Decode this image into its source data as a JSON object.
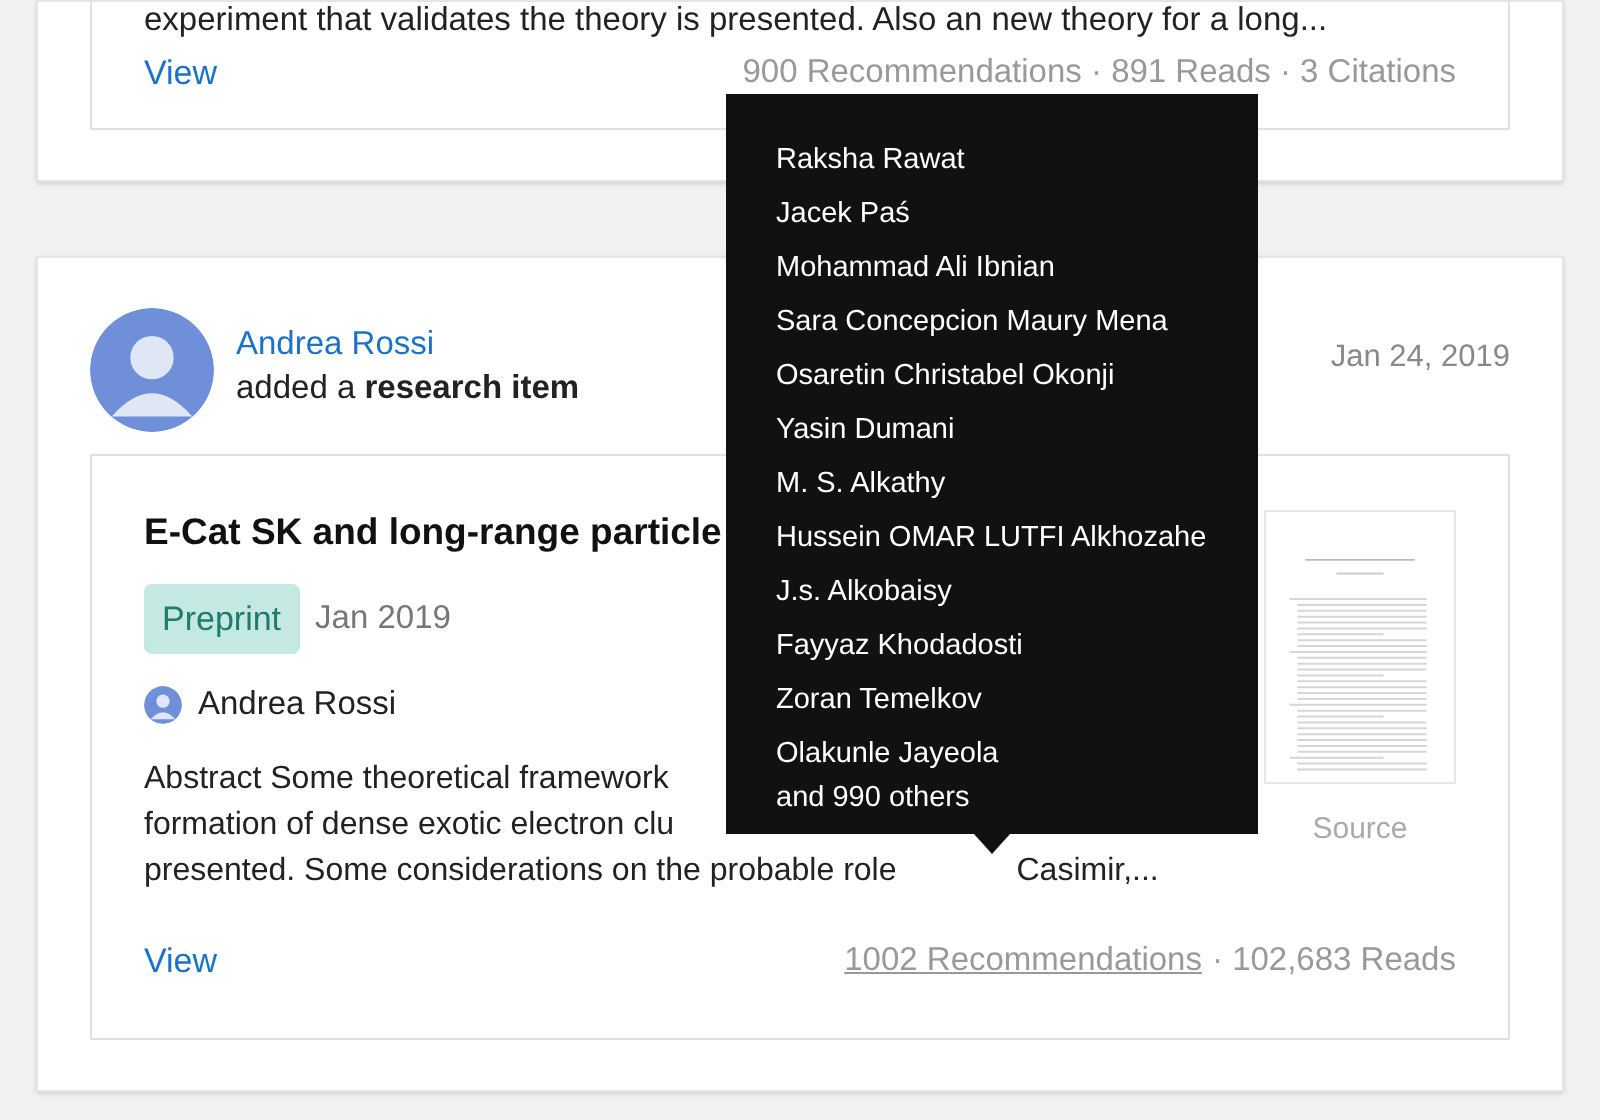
{
  "previous_item": {
    "excerpt": "experiment that validates the theory is presented. Also an new theory for a long...",
    "view_link": "View",
    "stats": "900 Recommendations · 891 Reads · 3 Citations"
  },
  "item": {
    "author": "Andrea Rossi",
    "action": "added a **research item**",
    "date": "Jan 24, 2019",
    "title": "E-Cat SK and long-range particle",
    "type_badge": "Preprint",
    "pub_date": "Jan 2019",
    "authors": [
      "Andrea Rossi"
    ],
    "abstract_lines": [
      "Abstract Some theoretical framework",
      "formation of dense exotic electron clu",
      "presented. Some considerations on the probable role"
    ],
    "abstract_tail": "Casimir,...",
    "view_link": "View",
    "recommendations": "1002 Recommendations",
    "reads": "· 102,683 Reads",
    "preview_caption": "Source"
  },
  "tooltip": {
    "names": [
      "Raksha Rawat",
      "Jacek Paś",
      "Mohammad Ali Ibnian",
      "Sara Concepcion Maury Mena",
      "Osaretin Christabel Okonji",
      "Yasin Dumani",
      "M. S. Alkathy",
      "Hussein OMAR LUTFI Alkhozahe",
      "J.s. Alkobaisy",
      "Fayyaz Khodadosti",
      "Zoran Temelkov",
      "Olakunle Jayeola"
    ],
    "more": "and 990 others"
  }
}
